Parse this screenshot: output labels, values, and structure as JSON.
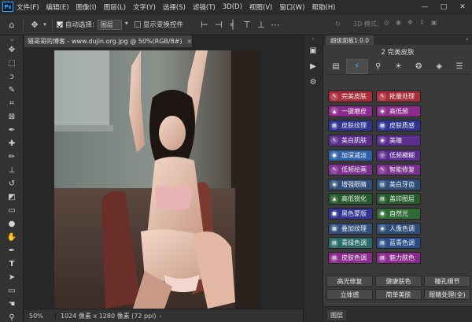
{
  "menubar": {
    "logo": "Ps",
    "items": [
      "文件(F)",
      "编辑(E)",
      "图像(I)",
      "图层(L)",
      "文字(Y)",
      "选择(S)",
      "滤镜(T)",
      "3D(D)",
      "视图(V)",
      "窗口(W)",
      "帮助(H)"
    ]
  },
  "window_controls": [
    "—",
    "□",
    "✕"
  ],
  "options": {
    "auto_select_label": "自动选择:",
    "auto_select_value": "图层",
    "show_transform_label": "显示变换控件",
    "mode_3d_label": "3D 模式:"
  },
  "document": {
    "tab_title": "猎哥哥的博客 - www.dujin.org.jpg @ 50%(RGB/8#)",
    "tab_close": "×",
    "zoom": "50%",
    "info": "1024 像素 x 1280 像素 (72 ppi)"
  },
  "panel": {
    "tab_title": "超级面板1.0.0",
    "collapse": "»",
    "subtitle": "2 完美皮肤",
    "feature_buttons": [
      {
        "label": "完美皮肤",
        "color": "#a92d3a",
        "icon": "✎"
      },
      {
        "label": "批量处理",
        "color": "#a92d3a",
        "icon": "✎"
      },
      {
        "label": "一键磨皮",
        "color": "#8c2b8e",
        "icon": "▲"
      },
      {
        "label": "高低频",
        "color": "#8c2b8e",
        "icon": "◆"
      },
      {
        "label": "皮肤纹理",
        "color": "#2f3590",
        "icon": "▦"
      },
      {
        "label": "皮肤质感",
        "color": "#2f3590",
        "icon": "▦"
      },
      {
        "label": "美白肌肤",
        "color": "#5b2d8e",
        "icon": "✎"
      },
      {
        "label": "美瞳",
        "color": "#5b2d8e",
        "icon": "◉"
      },
      {
        "label": "加深减淡",
        "color": "#2f62a8",
        "icon": "●"
      },
      {
        "label": "低频模糊",
        "color": "#5b2d8e",
        "icon": "◎"
      },
      {
        "label": "低频绘画",
        "color": "#7b2f8e",
        "icon": "✎"
      },
      {
        "label": "智能修复",
        "color": "#7b2f8e",
        "icon": "✎"
      },
      {
        "label": "增强眼睛",
        "color": "#2f4f7a",
        "icon": "◉"
      },
      {
        "label": "美白牙齿",
        "color": "#2f4f7a",
        "icon": "▤"
      },
      {
        "label": "高低锐化",
        "color": "#245a2c",
        "icon": "▲"
      },
      {
        "label": "盖印图层",
        "color": "#245a2c",
        "icon": "▤"
      },
      {
        "label": "黑色蒙版",
        "color": "#2f3590",
        "icon": "■"
      },
      {
        "label": "自然光",
        "color": "#2f6a36",
        "icon": "●"
      },
      {
        "label": "叠加纹理",
        "color": "#2f4f7a",
        "icon": "▦"
      },
      {
        "label": "人像色调",
        "color": "#2f4f7a",
        "icon": "◉"
      },
      {
        "label": "青绿色调",
        "color": "#2a6a6a",
        "icon": "▤"
      },
      {
        "label": "蓝青色调",
        "color": "#2a4e8a",
        "icon": "▤"
      },
      {
        "label": "皮肤色调",
        "color": "#8c2b8e",
        "icon": "▤"
      },
      {
        "label": "魅力肤色",
        "color": "#8c2b8e",
        "icon": "▤"
      }
    ],
    "plain_buttons": [
      [
        "高光修复",
        "健康肤色",
        "瞳孔细节"
      ],
      [
        "立体感",
        "简单美肤",
        "眼睛处理(全)"
      ]
    ],
    "layers_tab": "图层"
  },
  "colors": {
    "accent": "#31a8ff",
    "panel_bg": "#3a3a3a",
    "workspace": "#282828"
  }
}
